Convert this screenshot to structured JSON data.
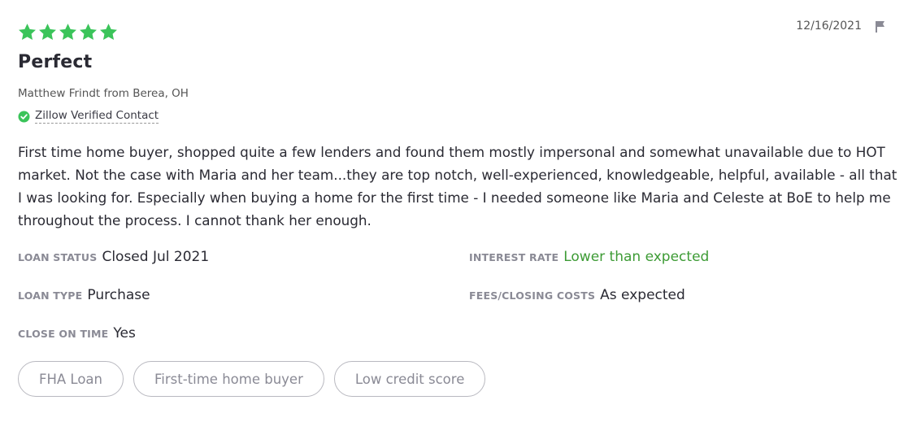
{
  "review": {
    "rating": 5,
    "max_rating": 5,
    "star_color": "#3bc45a",
    "date": "12/16/2021",
    "title": "Perfect",
    "reviewer": "Matthew Frindt from Berea, OH",
    "verified_label": "Zillow Verified Contact",
    "verified_color": "#3bc45a",
    "body": "First time home buyer, shopped quite a few lenders and found them mostly impersonal and somewhat unavailable due to HOT market. Not the case with Maria and her team...they are top notch, well-experienced, knowledgeable, helpful, available - all that I was looking for. Especially when buying a home for the first time - I needed someone like Maria and Celeste at BoE to help me throughout the process. I cannot thank her enough."
  },
  "details": {
    "loan_status": {
      "label": "LOAN STATUS",
      "value": "Closed Jul 2021"
    },
    "interest_rate": {
      "label": "INTEREST RATE",
      "value": "Lower than expected",
      "value_color": "#3d9b35"
    },
    "loan_type": {
      "label": "LOAN TYPE",
      "value": "Purchase"
    },
    "fees": {
      "label": "FEES/CLOSING COSTS",
      "value": "As expected"
    },
    "close_on_time": {
      "label": "CLOSE ON TIME",
      "value": "Yes"
    }
  },
  "tags": [
    "FHA Loan",
    "First-time home buyer",
    "Low credit score"
  ],
  "icons": {
    "star": "star-icon",
    "flag": "flag-icon",
    "verified": "check-circle-icon"
  }
}
